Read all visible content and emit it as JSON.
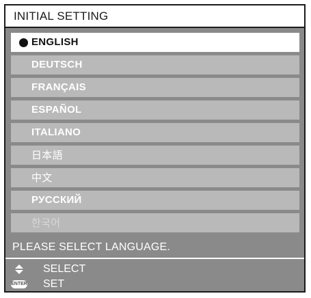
{
  "title": "INITIAL SETTING",
  "languages": [
    {
      "label": "ENGLISH",
      "selected": true
    },
    {
      "label": "DEUTSCH",
      "selected": false
    },
    {
      "label": "FRANÇAIS",
      "selected": false
    },
    {
      "label": "ESPAÑOL",
      "selected": false
    },
    {
      "label": "ITALIANO",
      "selected": false
    },
    {
      "label": "日本語",
      "selected": false
    },
    {
      "label": "中文",
      "selected": false
    },
    {
      "label": "РУССКИЙ",
      "selected": false
    },
    {
      "label": "한국어",
      "selected": false
    }
  ],
  "message": "PLEASE SELECT LANGUAGE.",
  "hints": {
    "select_label": "SELECT",
    "set_label": "SET",
    "enter_key": "ENTER"
  },
  "colors": {
    "panel_gray": "#8a8a8a",
    "item_gray": "#b9b9b9",
    "highlight": "#ffffff"
  },
  "icons": {
    "select": "up-down-arrows-icon",
    "set": "enter-key-icon",
    "selected_marker": "bullet-dot-icon"
  }
}
